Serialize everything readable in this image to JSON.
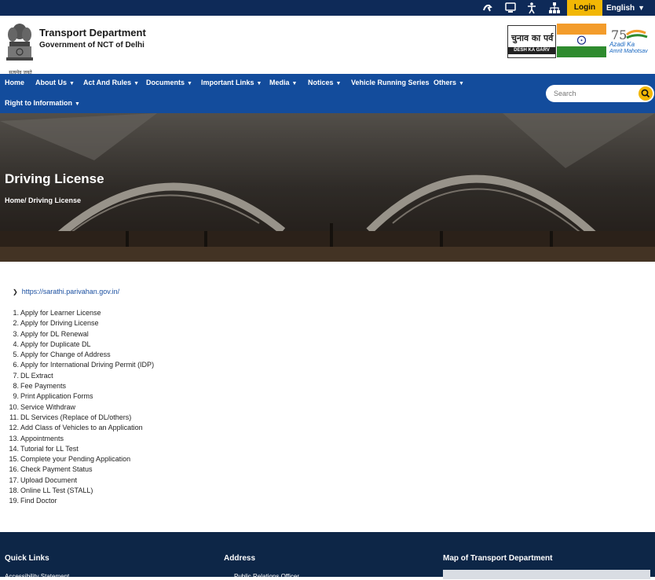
{
  "topbar": {
    "icons": [
      "sign-language-icon",
      "screen-reader-icon",
      "accessibility-icon",
      "sitemap-icon"
    ],
    "login_label": "Login",
    "language_label": "English"
  },
  "header": {
    "emblem_caption": "सत्यमेव जयते",
    "title": "Transport Department",
    "subtitle": "Government of NCT of Delhi",
    "chunav_text": "चुनाव का पर्व",
    "chunav_sub": "DESH KA GARV",
    "azadi_line1": "Azadi Ka",
    "azadi_line2": "Amrit Mahotsav"
  },
  "nav": {
    "items": [
      {
        "label": "Home",
        "dropdown": false
      },
      {
        "label": "About Us",
        "dropdown": true
      },
      {
        "label": "Act And Rules",
        "dropdown": true
      },
      {
        "label": "Documents",
        "dropdown": true
      },
      {
        "label": "Important Links",
        "dropdown": true
      },
      {
        "label": "Media",
        "dropdown": true
      },
      {
        "label": "Notices",
        "dropdown": true
      },
      {
        "label": "Vehicle Running Series",
        "dropdown": false
      },
      {
        "label": "Others",
        "dropdown": true
      },
      {
        "label": "Right to Information",
        "dropdown": true
      }
    ],
    "search_placeholder": "Search"
  },
  "hero": {
    "title": "Driving License",
    "breadcrumb": "Home/ Driving License"
  },
  "content": {
    "link": "https://sarathi.parivahan.gov.in/",
    "items": [
      "Apply for Learner License",
      "Apply for Driving License",
      "Apply for DL Renewal",
      "Apply for Duplicate DL",
      "Apply for Change of Address",
      "Apply for International Driving Permit (IDP)",
      "DL Extract",
      "Fee Payments",
      "Print Application Forms",
      "Service Withdraw",
      "DL Services (Replace of DL/others)",
      "Add Class of Vehicles to an Application",
      "Appointments",
      "Tutorial for LL Test",
      "Complete your Pending Application",
      "Check Payment Status",
      "Upload Document",
      "Online LL Test (STALL)",
      "Find Doctor"
    ]
  },
  "footer": {
    "quick_links_heading": "Quick Links",
    "address_heading": "Address",
    "map_heading": "Map of Transport Department",
    "quick_link_first": "Accessibility Statement",
    "address_first": "Public Relations Officer"
  },
  "colors": {
    "topbar": "#0e2a58",
    "nav": "#134c9c",
    "accent": "#f2b705",
    "footer": "#0d2647",
    "link": "#1a4fa0"
  }
}
